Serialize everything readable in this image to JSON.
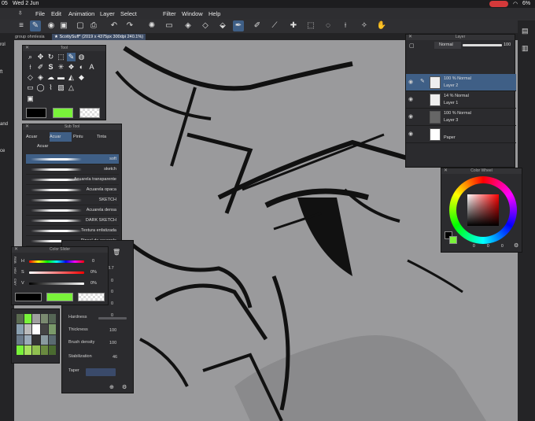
{
  "status": {
    "time": "05",
    "date": "Wed 2 Jun",
    "battery": "6%"
  },
  "menu": {
    "items": [
      "File",
      "Edit",
      "Animation",
      "Layer",
      "Select",
      "Filter",
      "Window",
      "Help"
    ]
  },
  "tabs": [
    {
      "label": "group ohmlesia"
    },
    {
      "label": "★ ScottySuff* (2019 x 4375px 300dpi 240.1%)"
    }
  ],
  "left_strip": {
    "labels": [
      "rol",
      "ft",
      "and",
      "ce"
    ]
  },
  "tool_panel": {
    "title": "Tool"
  },
  "subtool_panel": {
    "title": "Sub Tool",
    "tabs": [
      "Acuar",
      "Acuar",
      "Pintu",
      "Tinta"
    ],
    "group": "Acuar",
    "brushes": [
      "soft",
      "sketch",
      "Acuarela transparente",
      "Acuarela opaca",
      "SKETCH",
      "Acuarela densa",
      "DARK SKETCH",
      "Textura enfatizada",
      "Pincel de acuarela"
    ]
  },
  "color_slider": {
    "title": "Color Slider",
    "labels": [
      "H",
      "S",
      "V"
    ],
    "values": [
      "0",
      "0%",
      "0%"
    ],
    "side_tabs": [
      "RGB",
      "HSV",
      "CMY"
    ]
  },
  "tool_property": {
    "values": [
      "3.7",
      "0",
      "0",
      "0",
      "0"
    ],
    "rows": [
      {
        "label": "Hardness",
        "value": ""
      },
      {
        "label": "Thickness",
        "value": "100"
      },
      {
        "label": "Brush density",
        "value": "100"
      },
      {
        "label": "Stabilization",
        "value": "46"
      },
      {
        "label": "Taper",
        "value": ""
      }
    ]
  },
  "layer_panel": {
    "title": "Layer",
    "blend_mode": "Normal",
    "opacity": "100",
    "layers": [
      {
        "mode": "100 % Normal",
        "name": "Layer 2",
        "selected": true
      },
      {
        "mode": "14 % Normal",
        "name": "Layer 1",
        "selected": false
      },
      {
        "mode": "100 % Normal",
        "name": "Layer 3",
        "selected": false
      },
      {
        "mode": "",
        "name": "Paper",
        "selected": false
      }
    ]
  },
  "color_wheel": {
    "title": "Color Wheel",
    "values": [
      "0",
      "0",
      "0"
    ]
  },
  "colors": {
    "accent": "#3f5f86",
    "main_color": "#000000",
    "sub_color": "#79f23a",
    "canvas": "#9a9a9c"
  }
}
